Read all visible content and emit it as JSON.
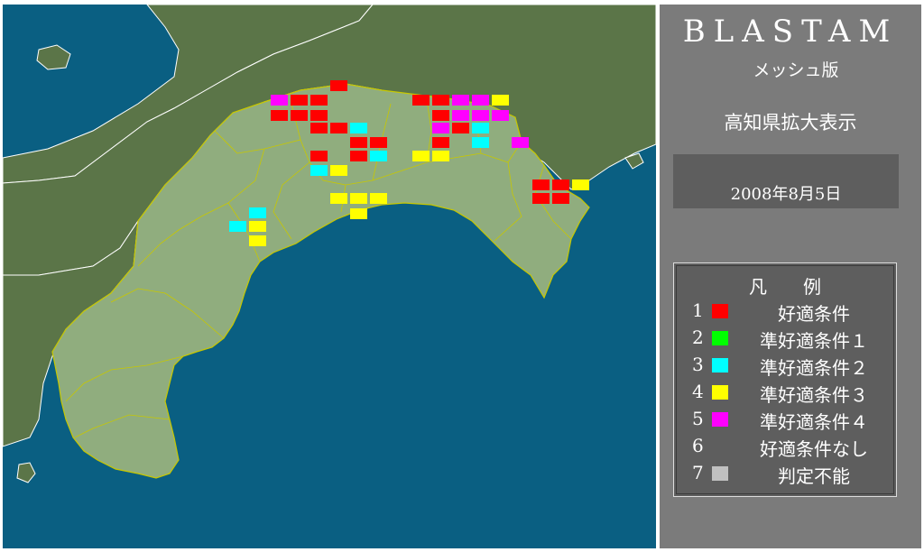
{
  "panel": {
    "title": "BLASTAM",
    "subtitle": "メッシュ版",
    "region": "高知県拡大表示",
    "date": "2008年8月5日"
  },
  "legend": {
    "title": "凡　　例",
    "items": [
      {
        "num": "1",
        "label": "好適条件",
        "color": "#ff0000"
      },
      {
        "num": "2",
        "label": "準好適条件１",
        "color": "#00ff00"
      },
      {
        "num": "3",
        "label": "準好適条件２",
        "color": "#00ffff"
      },
      {
        "num": "4",
        "label": "準好適条件３",
        "color": "#ffff00"
      },
      {
        "num": "5",
        "label": "準好適条件４",
        "color": "#ff00ff"
      },
      {
        "num": "6",
        "label": "好適条件なし",
        "color": ""
      },
      {
        "num": "7",
        "label": "判定不能",
        "color": "#c0c0c0"
      }
    ]
  },
  "map": {
    "colors": {
      "sea": "#0a5f82",
      "land_other": "#5b7548",
      "land_kochi": "#90ad7e",
      "border": "#c8c800"
    },
    "cells": [
      {
        "c": "magenta"
      },
      {
        "c": "red"
      },
      {
        "c": "red"
      },
      {
        "c": "red"
      },
      {
        "c": "red"
      },
      {
        "c": "red"
      },
      {
        "c": "red"
      },
      {
        "c": "red"
      },
      {
        "c": "red"
      },
      {
        "c": "cyan"
      },
      {
        "c": "red"
      },
      {
        "c": "red"
      },
      {
        "c": "red"
      },
      {
        "c": "cyan"
      },
      {
        "c": "cyan"
      },
      {
        "c": "yellow"
      },
      {
        "c": "red"
      },
      {
        "c": "yellow"
      },
      {
        "c": "yellow"
      },
      {
        "c": "yellow"
      },
      {
        "c": "yellow"
      },
      {
        "c": "cyan"
      },
      {
        "c": "cyan"
      },
      {
        "c": "yellow"
      },
      {
        "c": "yellow"
      },
      {
        "c": "red"
      },
      {
        "c": "red"
      },
      {
        "c": "magenta"
      },
      {
        "c": "magenta"
      },
      {
        "c": "yellow"
      },
      {
        "c": "red"
      },
      {
        "c": "magenta"
      },
      {
        "c": "magenta"
      },
      {
        "c": "magenta"
      },
      {
        "c": "magenta"
      },
      {
        "c": "red"
      },
      {
        "c": "cyan"
      },
      {
        "c": "red"
      },
      {
        "c": "cyan"
      },
      {
        "c": "magenta"
      },
      {
        "c": "yellow"
      },
      {
        "c": "yellow"
      },
      {
        "c": "red"
      },
      {
        "c": "red"
      },
      {
        "c": "yellow"
      },
      {
        "c": "red"
      },
      {
        "c": "red"
      }
    ]
  }
}
